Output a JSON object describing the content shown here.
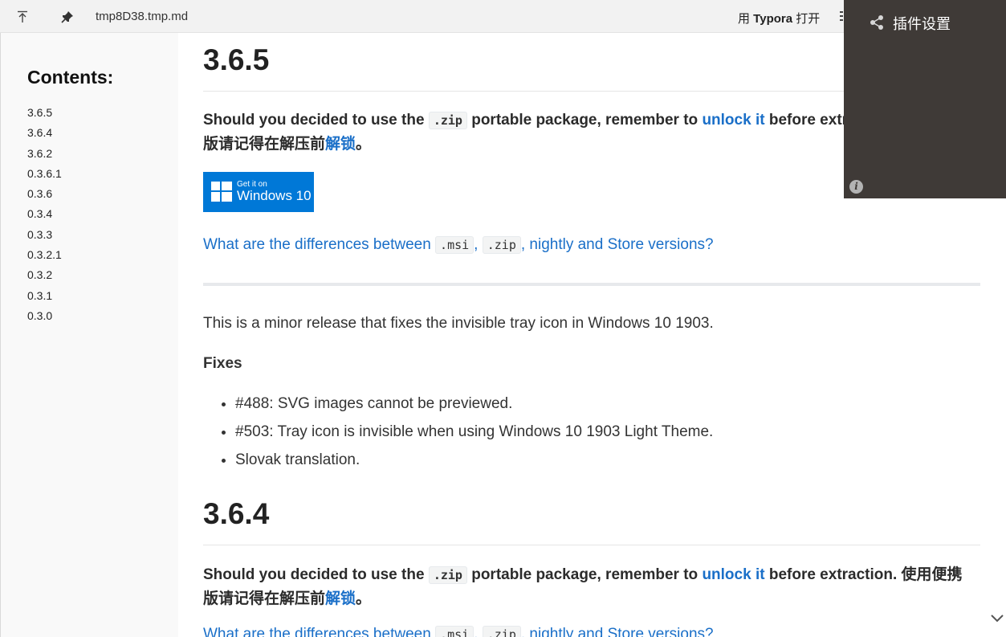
{
  "titlebar": {
    "file_name": "tmp8D38.tmp.md",
    "open_prefix": "用 ",
    "open_app": "Typora",
    "open_suffix": " 打开",
    "icons": [
      "arrow-up-icon",
      "pin-icon",
      "more-icon"
    ]
  },
  "toc": {
    "title": "Contents:",
    "items": [
      "3.6.5",
      "3.6.4",
      "3.6.2",
      "0.3.6.1",
      "0.3.6",
      "0.3.4",
      "0.3.3",
      "0.3.2.1",
      "0.3.2",
      "0.3.1",
      "0.3.0"
    ]
  },
  "sections": [
    {
      "heading": "3.6.5",
      "zip_intro": "Should you decided to use the ",
      "zip_code": ".zip",
      "zip_mid": " portable package, remember to ",
      "zip_link": "unlock it",
      "zip_after": " before extraction. 使用便携",
      "cn_line": "版请记得在解压前",
      "cn_link": "解锁",
      "cn_end": "。",
      "badge_small": "Get it on",
      "badge_big": "Windows 10",
      "diff_prefix": "What are the differences between ",
      "diff_code_msi": ".msi",
      "diff_comma": ", ",
      "diff_code_zip": ".zip",
      "diff_suffix": ", nightly and Store versions?",
      "description": "This is a minor release that fixes the invisible tray icon in Windows 10 1903.",
      "fixes_title": "Fixes",
      "fixes": [
        "#488: SVG images cannot be previewed.",
        "#503: Tray icon is invisible when using Windows 10 1903 Light Theme.",
        "Slovak translation."
      ]
    },
    {
      "heading": "3.6.4",
      "zip_intro": "Should you decided to use the ",
      "zip_code": ".zip",
      "zip_mid": " portable package, remember to ",
      "zip_link": "unlock it",
      "zip_after": " before extraction. 使用便携",
      "cn_line": "版请记得在解压前",
      "cn_link": "解锁",
      "cn_end": "。",
      "diff_prefix": "What are the differences between ",
      "diff_code_msi": ".msi",
      "diff_comma": ", ",
      "diff_code_zip": ".zip",
      "diff_suffix": ", nightly and Store versions?"
    }
  ],
  "plugin_panel": {
    "title": "插件设置",
    "icons": [
      "share-icon",
      "info-icon"
    ],
    "background": "#3f3a37"
  },
  "colors": {
    "link": "#1a6fc8",
    "windows_badge": "#0078d7"
  }
}
